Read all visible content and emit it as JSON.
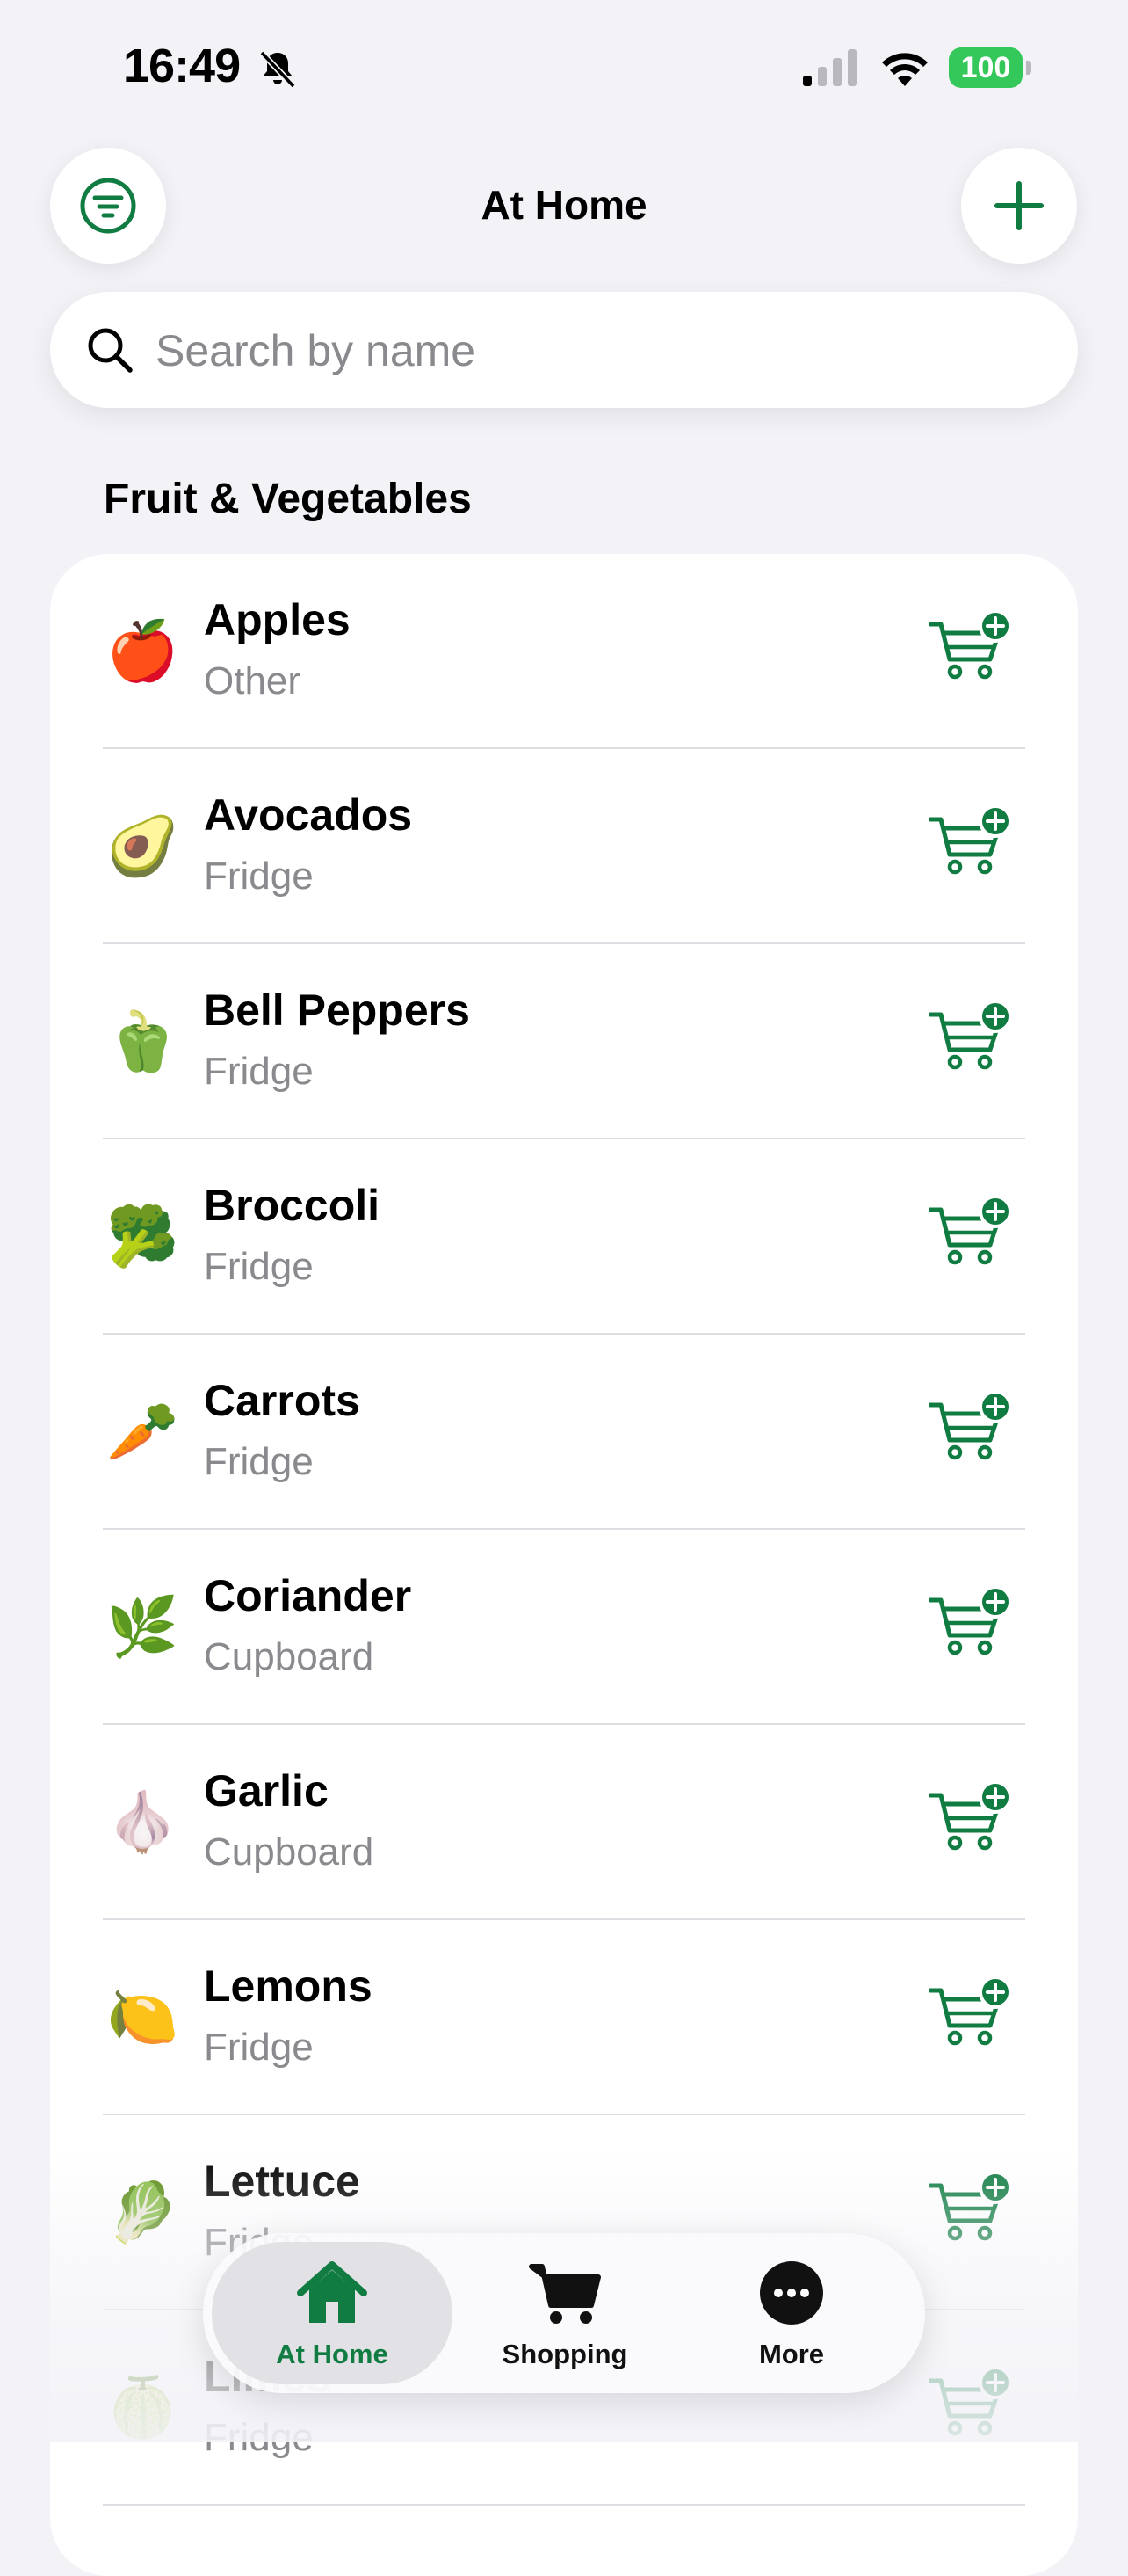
{
  "status_bar": {
    "time": "16:49",
    "battery": "100"
  },
  "header": {
    "title": "At Home"
  },
  "search": {
    "placeholder": "Search by name"
  },
  "section": {
    "title": "Fruit & Vegetables"
  },
  "items": [
    {
      "name": "Apples",
      "location": "Other",
      "emoji": "🍎"
    },
    {
      "name": "Avocados",
      "location": "Fridge",
      "emoji": "🥑"
    },
    {
      "name": "Bell Peppers",
      "location": "Fridge",
      "emoji": "🫑"
    },
    {
      "name": "Broccoli",
      "location": "Fridge",
      "emoji": "🥦"
    },
    {
      "name": "Carrots",
      "location": "Fridge",
      "emoji": "🥕"
    },
    {
      "name": "Coriander",
      "location": "Cupboard",
      "emoji": "🌿"
    },
    {
      "name": "Garlic",
      "location": "Cupboard",
      "emoji": "🧄"
    },
    {
      "name": "Lemons",
      "location": "Fridge",
      "emoji": "🍋"
    },
    {
      "name": "Lettuce",
      "location": "Fridge",
      "emoji": "🥬"
    },
    {
      "name": "Limes",
      "location": "Fridge",
      "emoji": "🍈"
    }
  ],
  "tabbar": {
    "home_label": "At Home",
    "shopping_label": "Shopping",
    "more_label": "More"
  },
  "colors": {
    "accent": "#107C41",
    "background": "#F2F2F7",
    "battery": "#34C759"
  },
  "icons": {
    "filter": "filter-icon",
    "add": "plus-icon",
    "search": "search-icon",
    "row_action": "cart-plus-icon",
    "tab_home": "house-icon",
    "tab_shopping": "cart-icon",
    "tab_more": "ellipsis-circle-icon"
  }
}
